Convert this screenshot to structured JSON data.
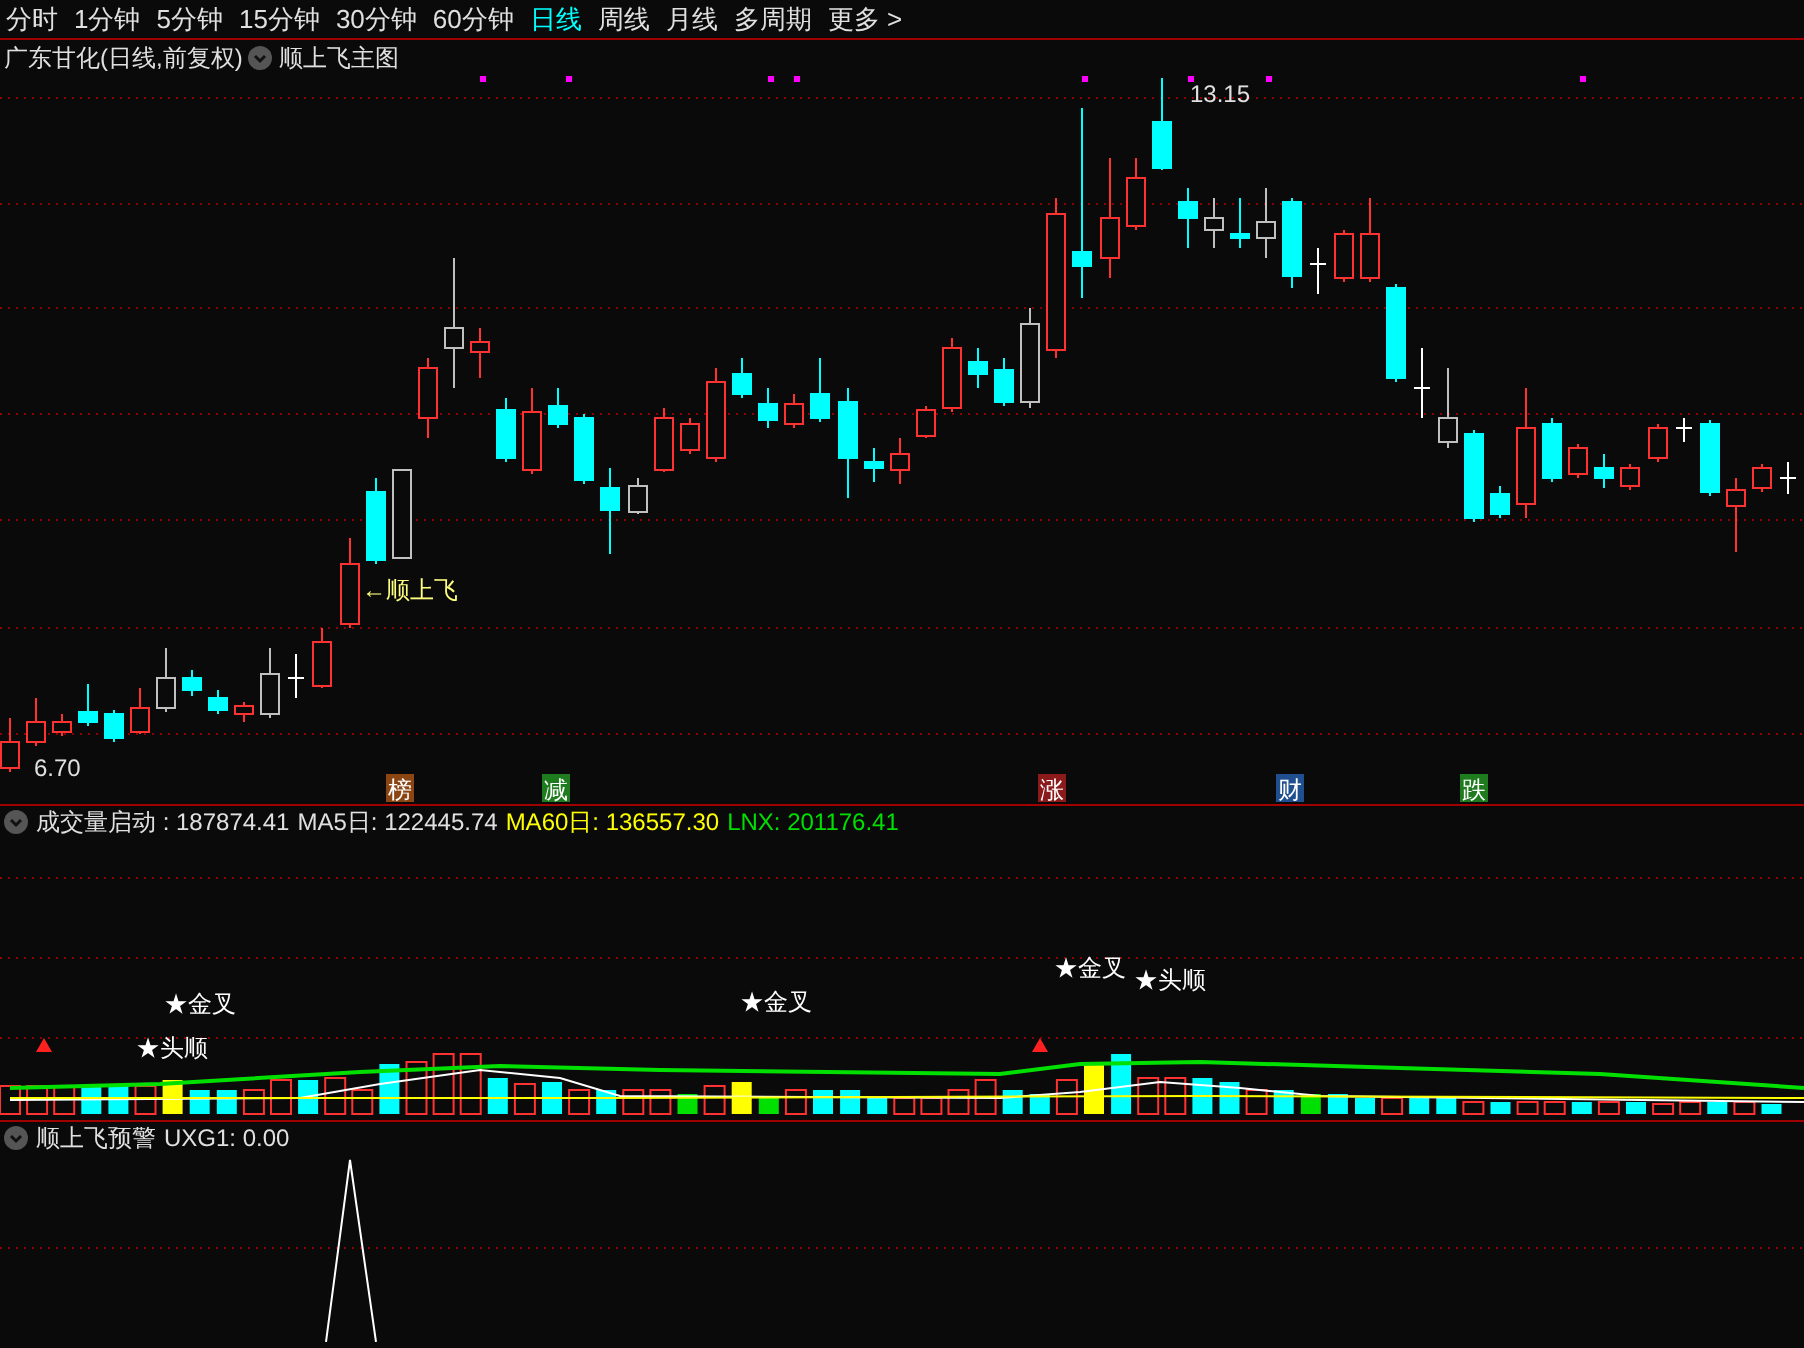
{
  "period_tabs": [
    {
      "label": "分时",
      "selected": false
    },
    {
      "label": "1分钟",
      "selected": false
    },
    {
      "label": "5分钟",
      "selected": false
    },
    {
      "label": "15分钟",
      "selected": false
    },
    {
      "label": "30分钟",
      "selected": false
    },
    {
      "label": "60分钟",
      "selected": false
    },
    {
      "label": "日线",
      "selected": true
    },
    {
      "label": "周线",
      "selected": false
    },
    {
      "label": "月线",
      "selected": false
    },
    {
      "label": "多周期",
      "selected": false
    },
    {
      "label": "更多 >",
      "selected": false
    }
  ],
  "main_panel": {
    "stock_title": "广东甘化(日线,前复权)",
    "indicator": "顺上飞主图",
    "high_label": "13.15",
    "low_label": "6.70",
    "signal_label": "←顺上飞",
    "event_tags": [
      {
        "text": "榜",
        "color": "#8b4513"
      },
      {
        "text": "减",
        "color": "#1e7b1e"
      },
      {
        "text": "涨",
        "color": "#8b1a1a"
      },
      {
        "text": "财",
        "color": "#1f4f8f"
      },
      {
        "text": "跌",
        "color": "#1e7b1e"
      }
    ]
  },
  "volume_panel": {
    "readings": [
      {
        "label": "成交量启动 : 187874.41",
        "color": "#e0e0e0"
      },
      {
        "label": "MA5日: 122445.74",
        "color": "#e0e0e0"
      },
      {
        "label": "MA60日: 136557.30",
        "color": "#ffff00"
      },
      {
        "label": "LNX: 201176.41",
        "color": "#00e000"
      }
    ],
    "signals": [
      {
        "text": "★金叉"
      },
      {
        "text": "★头顺"
      },
      {
        "text": "★金叉"
      },
      {
        "text": "★金叉"
      },
      {
        "text": "★头顺"
      }
    ]
  },
  "warning_panel": {
    "title": "顺上飞预警",
    "reading": "UXG1: 0.00"
  }
}
